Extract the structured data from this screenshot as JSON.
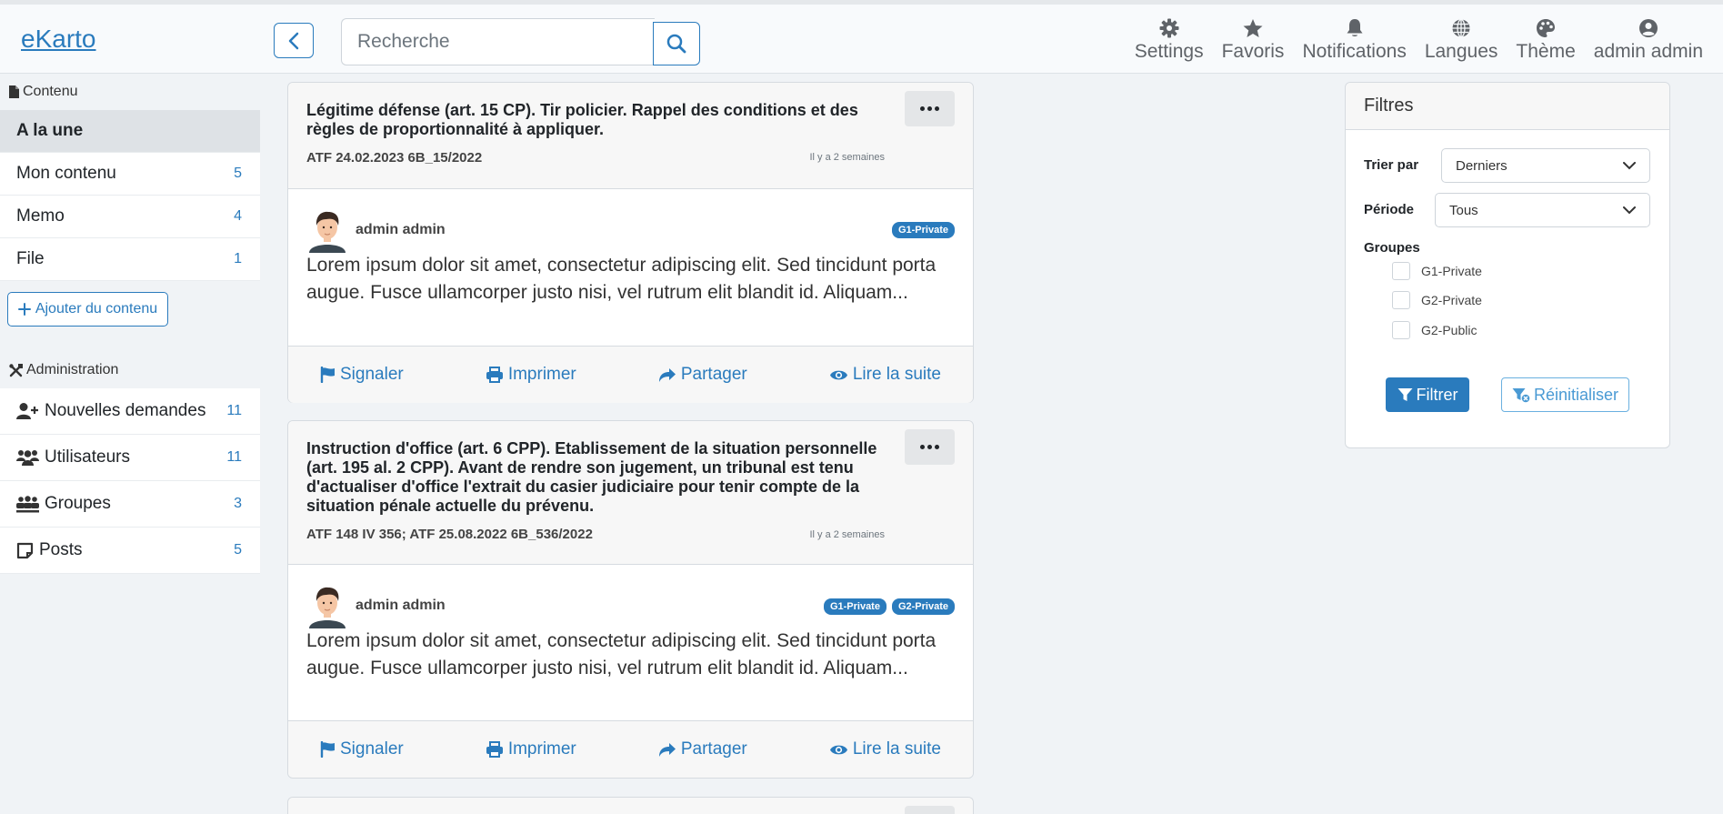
{
  "header": {
    "brand": "eKarto",
    "search_placeholder": "Recherche",
    "nav": [
      {
        "label": "Settings",
        "icon": "gear-icon"
      },
      {
        "label": "Favoris",
        "icon": "star-icon"
      },
      {
        "label": "Notifications",
        "icon": "bell-icon"
      },
      {
        "label": "Langues",
        "icon": "globe-icon"
      },
      {
        "label": "Thème",
        "icon": "palette-icon"
      },
      {
        "label": "admin admin",
        "icon": "user-circle-icon"
      }
    ]
  },
  "sidebar": {
    "content_heading": "Contenu",
    "content_items": [
      {
        "label": "A la une",
        "count": ""
      },
      {
        "label": "Mon contenu",
        "count": "5"
      },
      {
        "label": "Memo",
        "count": "4"
      },
      {
        "label": "File",
        "count": "1"
      }
    ],
    "add_label": "Ajouter du contenu",
    "admin_heading": "Administration",
    "admin_items": [
      {
        "label": "Nouvelles demandes",
        "count": "11",
        "icon": "user-plus-icon"
      },
      {
        "label": "Utilisateurs",
        "count": "11",
        "icon": "users-icon"
      },
      {
        "label": "Groupes",
        "count": "3",
        "icon": "group-icon"
      },
      {
        "label": "Posts",
        "count": "5",
        "icon": "sticky-note-icon"
      }
    ]
  },
  "posts": [
    {
      "title": "Légitime défense (art. 15 CP). Tir policier. Rappel des conditions et des règles de proportionnalité à appliquer.",
      "reference": "ATF 24.02.2023 6B_15/2022",
      "time": "Il y a 2 semaines",
      "author": "admin admin",
      "badges": [
        "G1-Private"
      ],
      "excerpt": "Lorem ipsum dolor sit amet, consectetur adipiscing elit. Sed tincidunt porta augue. Fusce ullamcorper justo nisi, vel rutrum elit blandit id. Aliquam..."
    },
    {
      "title": "Instruction d'office (art. 6 CPP). Etablissement de la situation personnelle (art. 195 al. 2 CPP). Avant de rendre son jugement, un tribunal est tenu d'actualiser d'office l'extrait du casier judiciaire pour tenir compte de la situation pénale actuelle du prévenu.",
      "reference": "ATF 148 IV 356; ATF 25.08.2022 6B_536/2022",
      "time": "Il y a 2 semaines",
      "author": "admin admin",
      "badges": [
        "G1-Private",
        "G2-Private"
      ],
      "excerpt": "Lorem ipsum dolor sit amet, consectetur adipiscing elit. Sed tincidunt porta augue. Fusce ullamcorper justo nisi, vel rutrum elit blandit id. Aliquam..."
    }
  ],
  "post_actions": {
    "report": "Signaler",
    "print": "Imprimer",
    "share": "Partager",
    "read_more": "Lire la suite"
  },
  "filters": {
    "title": "Filtres",
    "sort_label": "Trier par",
    "sort_value": "Derniers",
    "period_label": "Période",
    "period_value": "Tous",
    "groups_label": "Groupes",
    "groups": [
      "G1-Private",
      "G2-Private",
      "G2-Public"
    ],
    "filter_button": "Filtrer",
    "reset_button": "Réinitialiser"
  },
  "colors": {
    "accent": "#2a7bbd",
    "background": "#f0f3f6"
  }
}
